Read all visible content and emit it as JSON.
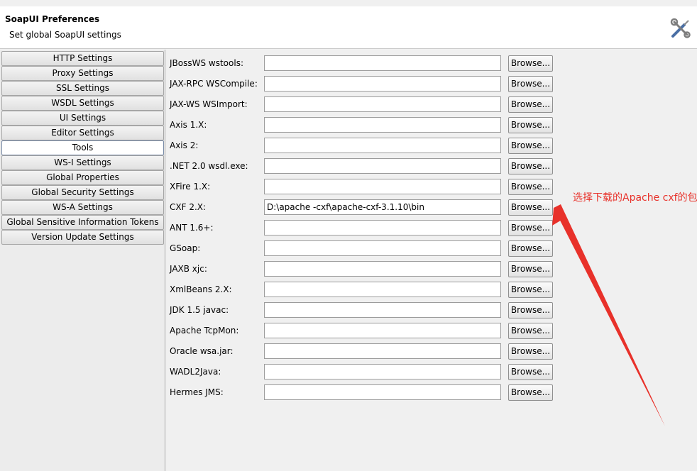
{
  "header": {
    "title": "SoapUI Preferences",
    "subtitle": "Set global SoapUI settings",
    "icon": "tools-icon"
  },
  "sidebar": {
    "items": [
      {
        "label": "HTTP Settings"
      },
      {
        "label": "Proxy Settings"
      },
      {
        "label": "SSL Settings"
      },
      {
        "label": "WSDL Settings"
      },
      {
        "label": "UI Settings"
      },
      {
        "label": "Editor Settings"
      },
      {
        "label": "Tools",
        "selected": true
      },
      {
        "label": "WS-I Settings"
      },
      {
        "label": "Global Properties"
      },
      {
        "label": "Global Security Settings"
      },
      {
        "label": "WS-A Settings"
      },
      {
        "label": "Global Sensitive Information Tokens"
      },
      {
        "label": "Version Update Settings"
      }
    ]
  },
  "tools": {
    "browse_label": "Browse...",
    "rows": [
      {
        "label": "JBossWS wstools:",
        "value": ""
      },
      {
        "label": "JAX-RPC WSCompile:",
        "value": ""
      },
      {
        "label": "JAX-WS WSImport:",
        "value": ""
      },
      {
        "label": "Axis 1.X:",
        "value": ""
      },
      {
        "label": "Axis 2:",
        "value": ""
      },
      {
        "label": ".NET 2.0 wsdl.exe:",
        "value": ""
      },
      {
        "label": "XFire 1.X:",
        "value": ""
      },
      {
        "label": "CXF 2.X:",
        "value": "D:\\apache -cxf\\apache-cxf-3.1.10\\bin"
      },
      {
        "label": "ANT 1.6+:",
        "value": ""
      },
      {
        "label": "GSoap:",
        "value": ""
      },
      {
        "label": "JAXB xjc:",
        "value": ""
      },
      {
        "label": "XmlBeans 2.X:",
        "value": ""
      },
      {
        "label": "JDK 1.5 javac:",
        "value": ""
      },
      {
        "label": "Apache TcpMon:",
        "value": ""
      },
      {
        "label": "Oracle wsa.jar:",
        "value": ""
      },
      {
        "label": "WADL2Java:",
        "value": ""
      },
      {
        "label": "Hermes JMS:",
        "value": ""
      }
    ]
  },
  "annotation": {
    "text": "选择下载的Apache cxf的包",
    "color": "#e8312a"
  }
}
